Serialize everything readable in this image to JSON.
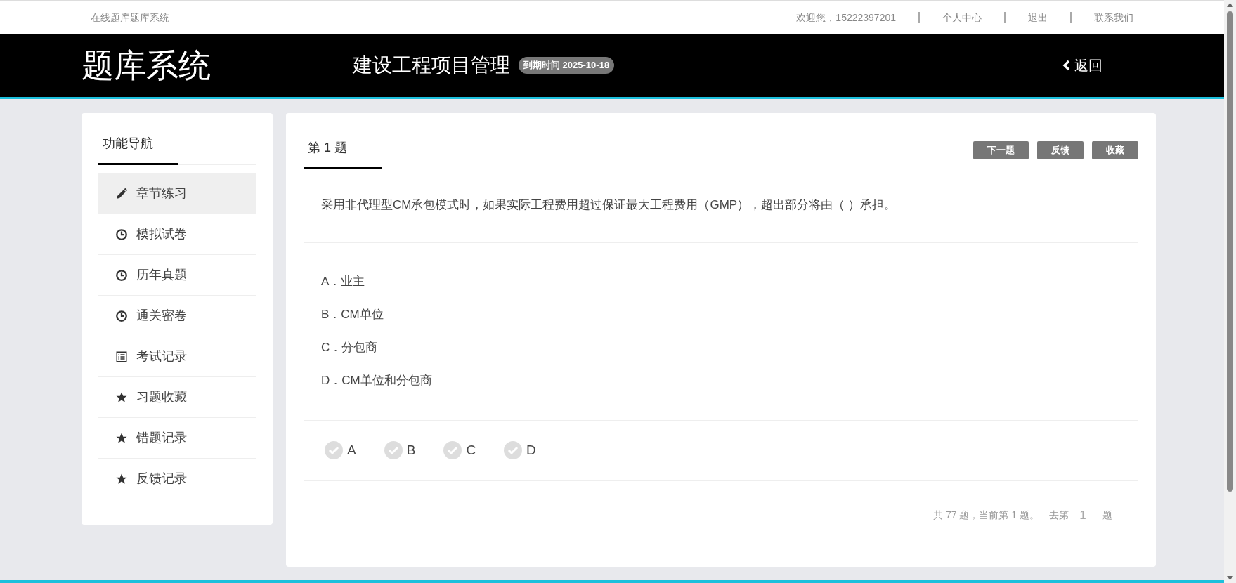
{
  "top_bar": {
    "site_name": "在线题库题库系统",
    "welcome": "欢迎您，15222397201",
    "links": [
      "个人中心",
      "退出",
      "联系我们"
    ]
  },
  "header": {
    "logo": "题库系统",
    "subject": "建设工程项目管理",
    "expiry_badge": "到期时间 2025-10-18",
    "back": "返回"
  },
  "sidebar": {
    "title": "功能导航",
    "items": [
      {
        "label": "章节练习",
        "kind": "pencil",
        "selected": true
      },
      {
        "label": "模拟试卷",
        "kind": "clock",
        "selected": false
      },
      {
        "label": "历年真题",
        "kind": "clock",
        "selected": false
      },
      {
        "label": "通关密卷",
        "kind": "clock",
        "selected": false
      },
      {
        "label": "考试记录",
        "kind": "list",
        "selected": false
      },
      {
        "label": "习题收藏",
        "kind": "star",
        "selected": false
      },
      {
        "label": "错题记录",
        "kind": "star",
        "selected": false
      },
      {
        "label": "反馈记录",
        "kind": "star",
        "selected": false
      }
    ]
  },
  "question": {
    "tab": "第 1 题",
    "buttons": [
      "下一题",
      "反馈",
      "收藏"
    ],
    "text": "采用非代理型CM承包模式时，如果实际工程费用超过保证最大工程费用（GMP），超出部分将由（ ）承担。",
    "options": [
      "A．业主",
      "B．CM单位",
      "C．分包商",
      "D．CM单位和分包商"
    ],
    "answers": [
      {
        "label": "A",
        "selected": false
      },
      {
        "label": "B",
        "selected": false
      },
      {
        "label": "C",
        "selected": false
      },
      {
        "label": "D",
        "selected": false
      }
    ],
    "pagination": {
      "summary": "共 77 题，当前第 1 题。",
      "goto_prefix": "去第",
      "page_value": "1",
      "goto_suffix": "题"
    }
  }
}
